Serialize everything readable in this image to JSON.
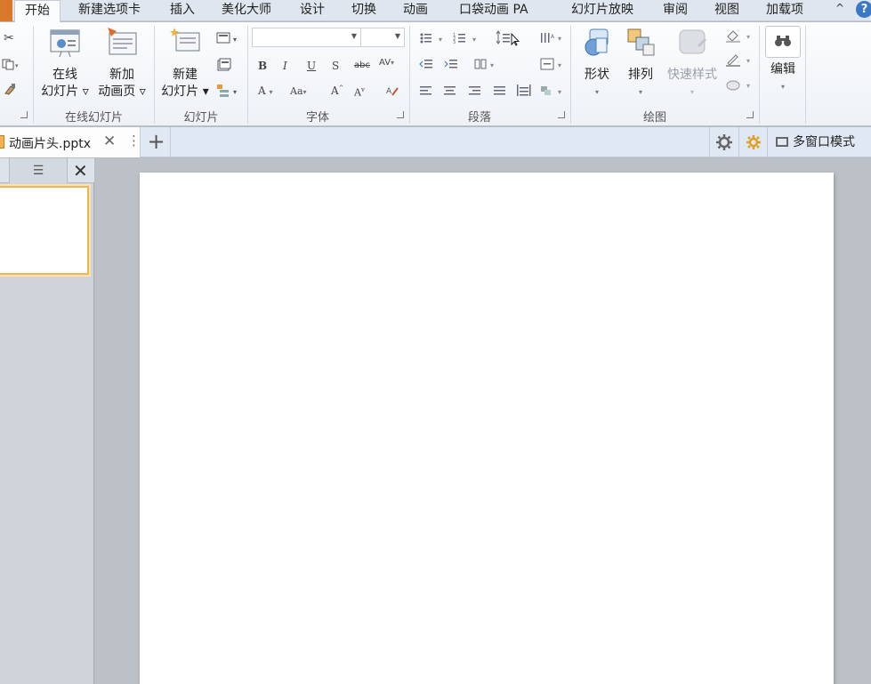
{
  "menu": {
    "tabs": [
      "开始",
      "新建选项卡",
      "插入",
      "美化大师",
      "设计",
      "切换",
      "动画",
      "口袋动画 PA",
      "幻灯片放映",
      "审阅",
      "视图",
      "加载项"
    ],
    "collapse_glyph": "^",
    "help_glyph": "?"
  },
  "ribbon": {
    "groups": {
      "online_slides": {
        "label": "在线幻灯片",
        "buttons": [
          {
            "line1": "在线",
            "line2": "幻灯片 ▿"
          },
          {
            "line1": "新加",
            "line2": "动画页 ▿"
          }
        ]
      },
      "slides": {
        "label": "幻灯片",
        "new_slide": {
          "line1": "新建",
          "line2": "幻灯片 ▾"
        }
      },
      "font": {
        "label": "字体"
      },
      "paragraph": {
        "label": "段落"
      },
      "drawing": {
        "label": "绘图",
        "shape": "形状",
        "arrange": "排列",
        "quick_style": "快速样式"
      },
      "editing": {
        "label": "编辑"
      }
    }
  },
  "docbar": {
    "file_name": "动画片头.pptx",
    "close_glyph": "✕",
    "more_glyph": "⋮",
    "new_tab_glyph": "+",
    "multi_window": "多窗口模式"
  },
  "colors": {
    "file_tab": "#d9772b",
    "thumb_selected": "#f0b555",
    "help": "#3b78c5"
  }
}
